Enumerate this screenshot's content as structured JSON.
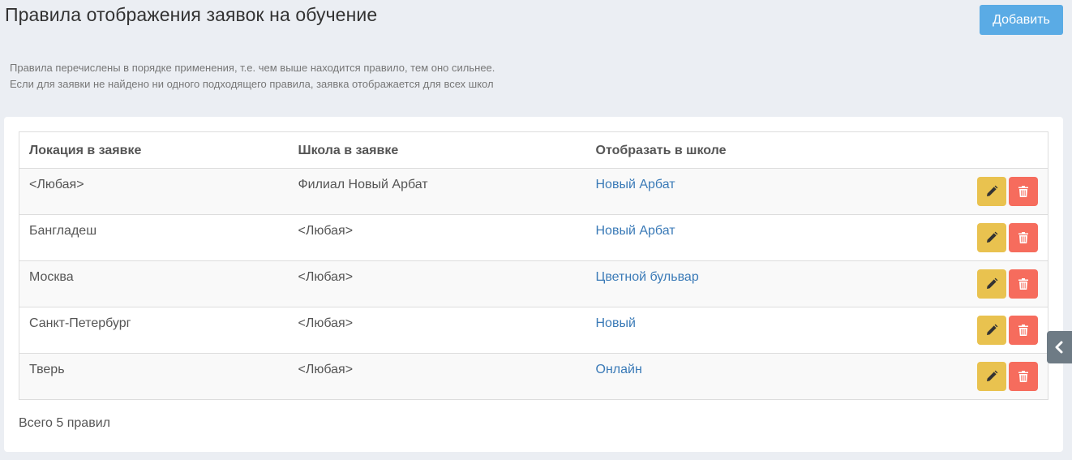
{
  "header": {
    "title": "Правила отображения заявок на обучение",
    "add_label": "Добавить"
  },
  "hint": {
    "line1": "Правила перечислены в порядке применения, т.е. чем выше находится правило, тем оно сильнее.",
    "line2": "Если для заявки не найдено ни одного подходящего правила, заявка отображается для всех школ"
  },
  "table": {
    "columns": [
      "Локация в заявке",
      "Школа в заявке",
      "Отобразать в школе"
    ],
    "rows": [
      {
        "location": "<Любая>",
        "school": "Филиал Новый Арбат",
        "display": "Новый Арбат"
      },
      {
        "location": "Бангладеш",
        "school": "<Любая>",
        "display": "Новый Арбат"
      },
      {
        "location": "Москва",
        "school": "<Любая>",
        "display": "Цветной бульвар"
      },
      {
        "location": "Санкт-Петербург",
        "school": "<Любая>",
        "display": "Новый"
      },
      {
        "location": "Тверь",
        "school": "<Любая>",
        "display": "Онлайн"
      }
    ]
  },
  "footer": {
    "total": "Всего 5 правил"
  },
  "icons": {
    "edit": "pencil-icon",
    "delete": "trash-icon",
    "side_toggle": "chevron-left-icon"
  },
  "colors": {
    "primary": "#5aabe5",
    "edit": "#e9c24f",
    "delete": "#f66c5d",
    "link": "#3a7ab7"
  }
}
